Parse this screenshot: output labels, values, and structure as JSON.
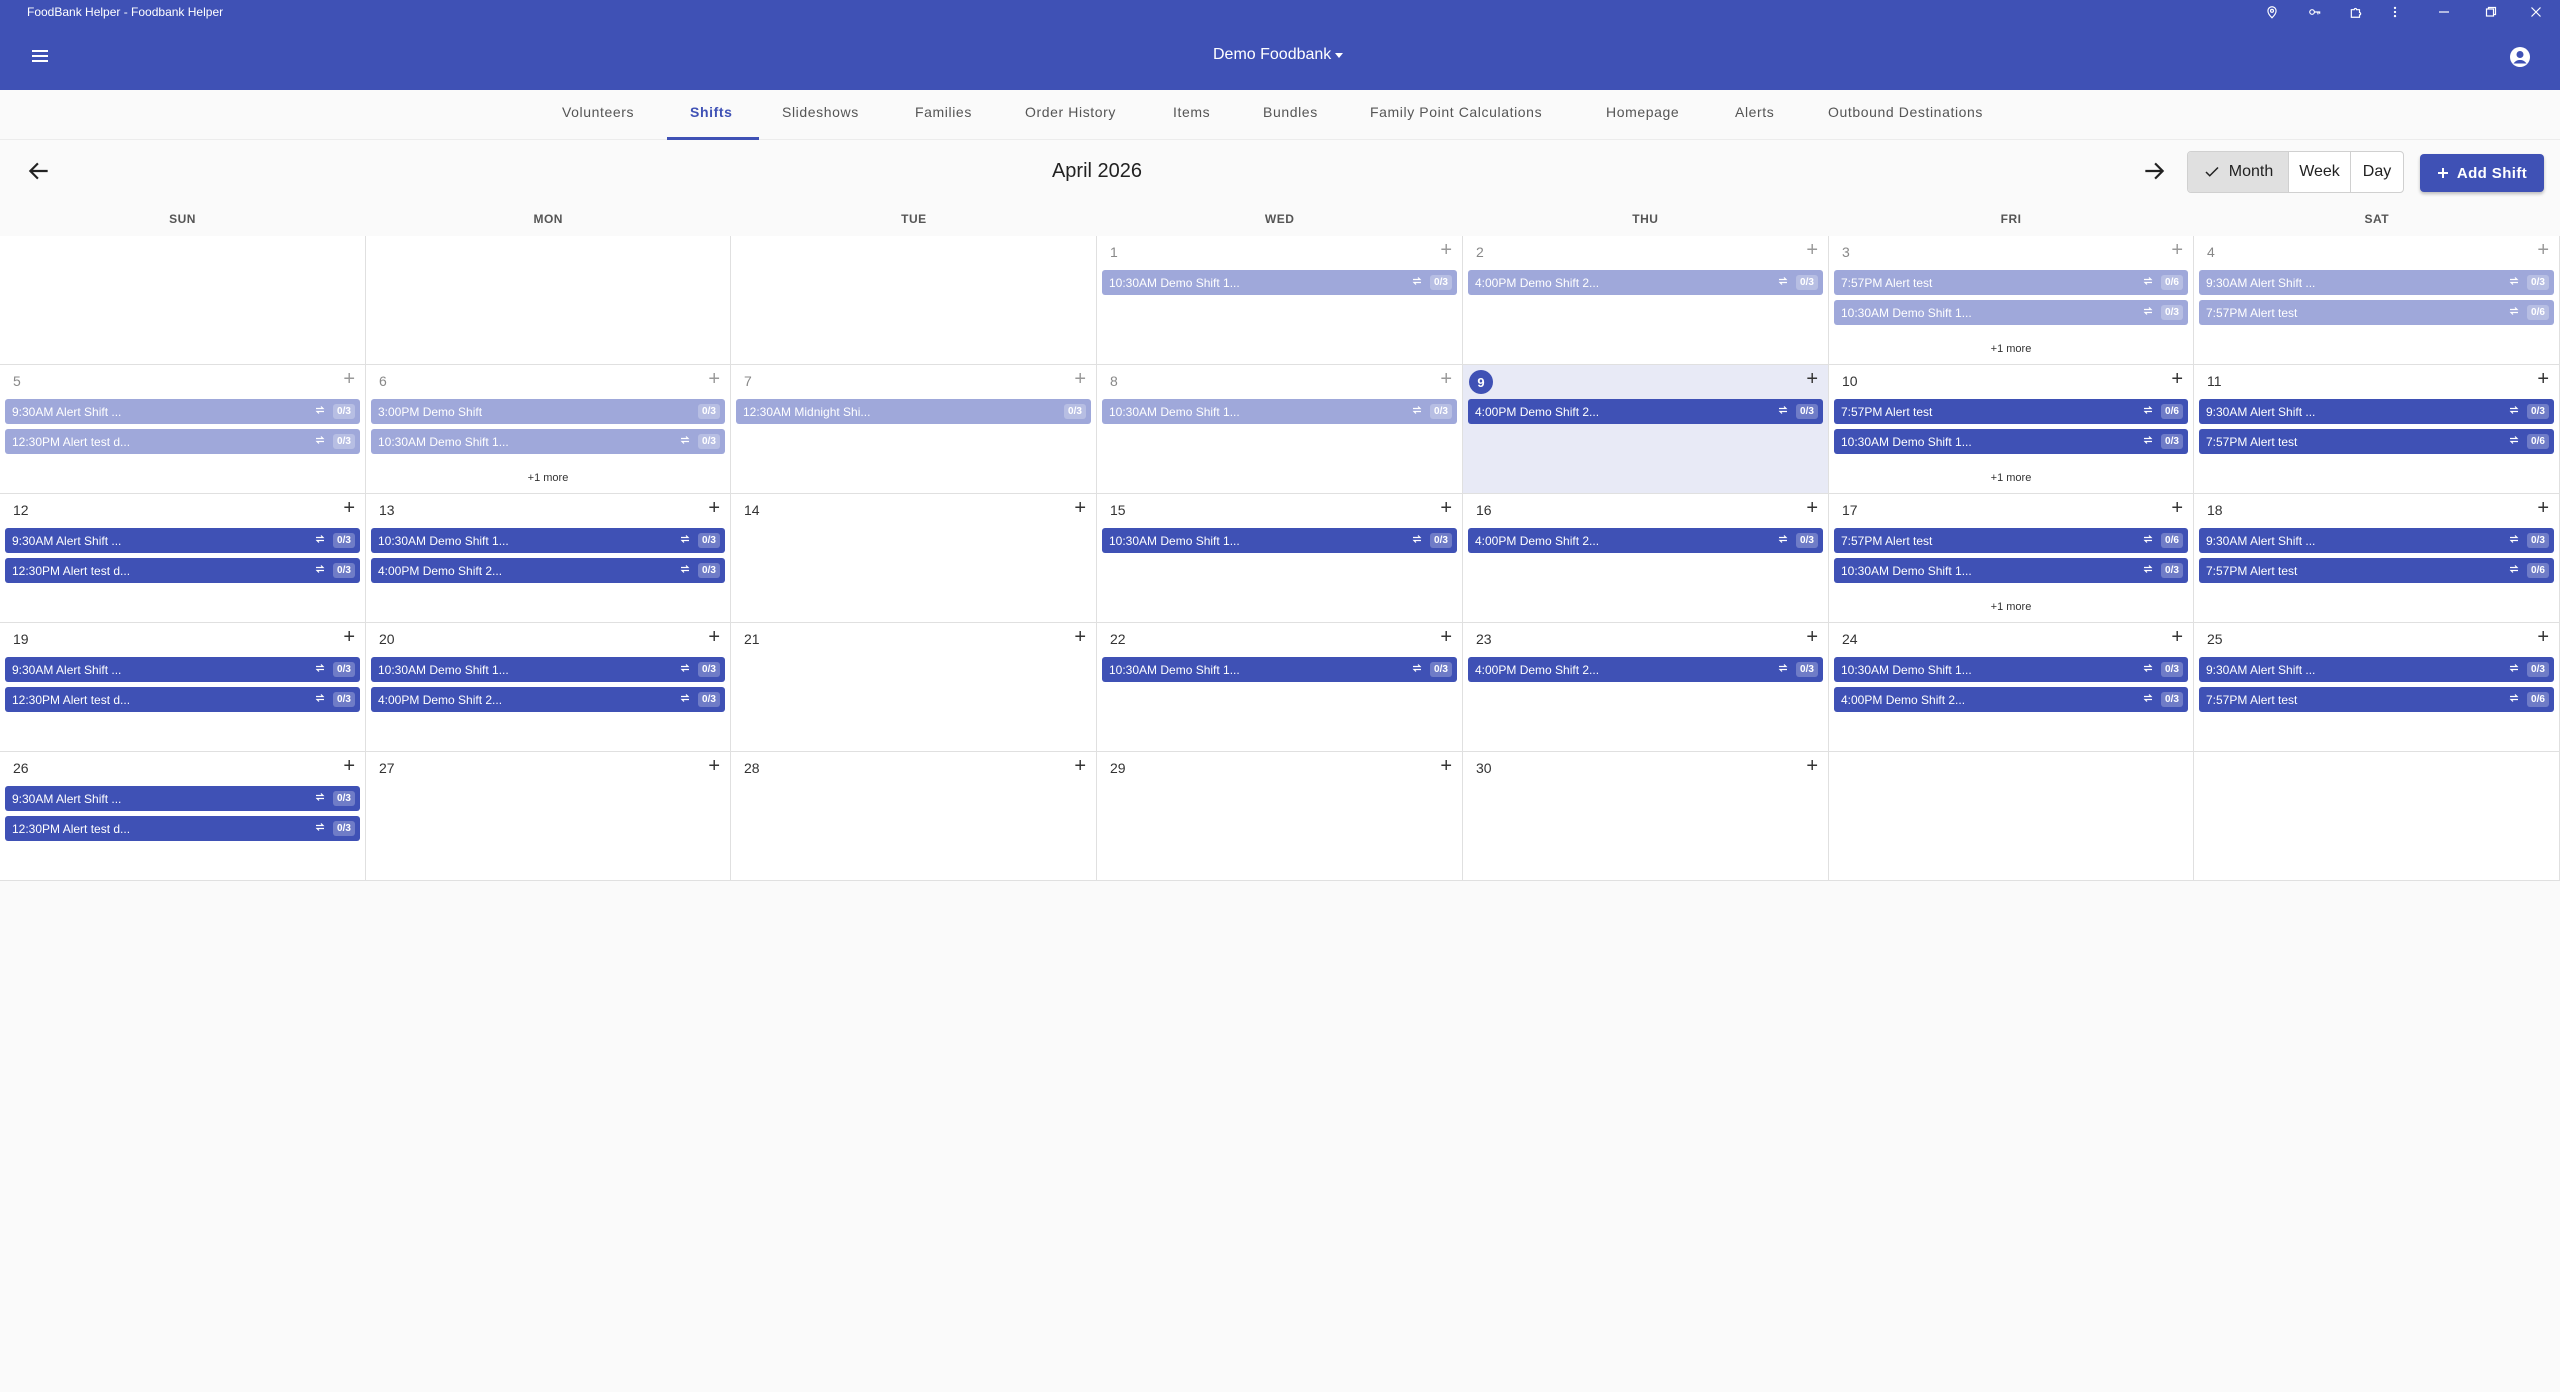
{
  "window": {
    "title": "FoodBank Helper - Foodbank Helper"
  },
  "header": {
    "org": "Demo Foodbank"
  },
  "tabs": [
    {
      "label": "Volunteers",
      "active": false
    },
    {
      "label": "Shifts",
      "active": true
    },
    {
      "label": "Slideshows",
      "active": false
    },
    {
      "label": "Families",
      "active": false
    },
    {
      "label": "Order History",
      "active": false
    },
    {
      "label": "Items",
      "active": false
    },
    {
      "label": "Bundles",
      "active": false
    },
    {
      "label": "Family Point Calculations",
      "active": false
    },
    {
      "label": "Homepage",
      "active": false
    },
    {
      "label": "Alerts",
      "active": false
    },
    {
      "label": "Outbound Destinations",
      "active": false
    }
  ],
  "calendar": {
    "month": "April 2026",
    "views": [
      "Month",
      "Week",
      "Day"
    ],
    "active_view": "Month",
    "add_shift": "Add Shift",
    "weekdays": [
      "SUN",
      "MON",
      "TUE",
      "WED",
      "THU",
      "FRI",
      "SAT"
    ],
    "today": 9,
    "first_weekday": 3,
    "days_in_month": 30,
    "days": {
      "1": {
        "events": [
          {
            "label": "10:30AM Demo Shift 1...",
            "badge": "0/3"
          }
        ]
      },
      "2": {
        "events": [
          {
            "label": "4:00PM Demo Shift 2...",
            "badge": "0/3"
          }
        ]
      },
      "3": {
        "events": [
          {
            "label": "7:57PM Alert test",
            "badge": "0/6"
          },
          {
            "label": "10:30AM Demo Shift 1...",
            "badge": "0/3"
          }
        ],
        "more": "+1 more"
      },
      "4": {
        "events": [
          {
            "label": "9:30AM Alert Shift ...",
            "badge": "0/3"
          },
          {
            "label": "7:57PM Alert test",
            "badge": "0/6"
          }
        ]
      },
      "5": {
        "events": [
          {
            "label": "9:30AM Alert Shift ...",
            "badge": "0/3"
          },
          {
            "label": "12:30PM Alert test d...",
            "badge": "0/3"
          }
        ]
      },
      "6": {
        "events": [
          {
            "label": "3:00PM Demo Shift",
            "badge": "0/3",
            "repeat": false
          },
          {
            "label": "10:30AM Demo Shift 1...",
            "badge": "0/3"
          }
        ],
        "more": "+1 more"
      },
      "7": {
        "events": [
          {
            "label": "12:30AM Midnight Shi...",
            "badge": "0/3",
            "repeat": false
          }
        ]
      },
      "8": {
        "events": [
          {
            "label": "10:30AM Demo Shift 1...",
            "badge": "0/3"
          }
        ]
      },
      "9": {
        "events": [
          {
            "label": "4:00PM Demo Shift 2...",
            "badge": "0/3"
          }
        ]
      },
      "10": {
        "events": [
          {
            "label": "7:57PM Alert test",
            "badge": "0/6"
          },
          {
            "label": "10:30AM Demo Shift 1...",
            "badge": "0/3"
          }
        ],
        "more": "+1 more"
      },
      "11": {
        "events": [
          {
            "label": "9:30AM Alert Shift ...",
            "badge": "0/3"
          },
          {
            "label": "7:57PM Alert test",
            "badge": "0/6"
          }
        ]
      },
      "12": {
        "events": [
          {
            "label": "9:30AM Alert Shift ...",
            "badge": "0/3"
          },
          {
            "label": "12:30PM Alert test d...",
            "badge": "0/3"
          }
        ]
      },
      "13": {
        "events": [
          {
            "label": "10:30AM Demo Shift 1...",
            "badge": "0/3"
          },
          {
            "label": "4:00PM Demo Shift 2...",
            "badge": "0/3"
          }
        ]
      },
      "15": {
        "events": [
          {
            "label": "10:30AM Demo Shift 1...",
            "badge": "0/3"
          }
        ]
      },
      "16": {
        "events": [
          {
            "label": "4:00PM Demo Shift 2...",
            "badge": "0/3"
          }
        ]
      },
      "17": {
        "events": [
          {
            "label": "7:57PM Alert test",
            "badge": "0/6"
          },
          {
            "label": "10:30AM Demo Shift 1...",
            "badge": "0/3"
          }
        ],
        "more": "+1 more"
      },
      "18": {
        "events": [
          {
            "label": "9:30AM Alert Shift ...",
            "badge": "0/3"
          },
          {
            "label": "7:57PM Alert test",
            "badge": "0/6"
          }
        ]
      },
      "19": {
        "events": [
          {
            "label": "9:30AM Alert Shift ...",
            "badge": "0/3"
          },
          {
            "label": "12:30PM Alert test d...",
            "badge": "0/3"
          }
        ]
      },
      "20": {
        "events": [
          {
            "label": "10:30AM Demo Shift 1...",
            "badge": "0/3"
          },
          {
            "label": "4:00PM Demo Shift 2...",
            "badge": "0/3"
          }
        ]
      },
      "22": {
        "events": [
          {
            "label": "10:30AM Demo Shift 1...",
            "badge": "0/3"
          }
        ]
      },
      "23": {
        "events": [
          {
            "label": "4:00PM Demo Shift 2...",
            "badge": "0/3"
          }
        ]
      },
      "24": {
        "events": [
          {
            "label": "10:30AM Demo Shift 1...",
            "badge": "0/3"
          },
          {
            "label": "4:00PM Demo Shift 2...",
            "badge": "0/3"
          }
        ]
      },
      "25": {
        "events": [
          {
            "label": "9:30AM Alert Shift ...",
            "badge": "0/3"
          },
          {
            "label": "7:57PM Alert test",
            "badge": "0/6"
          }
        ]
      },
      "26": {
        "events": [
          {
            "label": "9:30AM Alert Shift ...",
            "badge": "0/3"
          },
          {
            "label": "12:30PM Alert test d...",
            "badge": "0/3"
          }
        ]
      }
    }
  },
  "colors": {
    "primary": "#3f51b5",
    "past_event": "#9fa8da",
    "today_bg": "#e8eaf6"
  }
}
